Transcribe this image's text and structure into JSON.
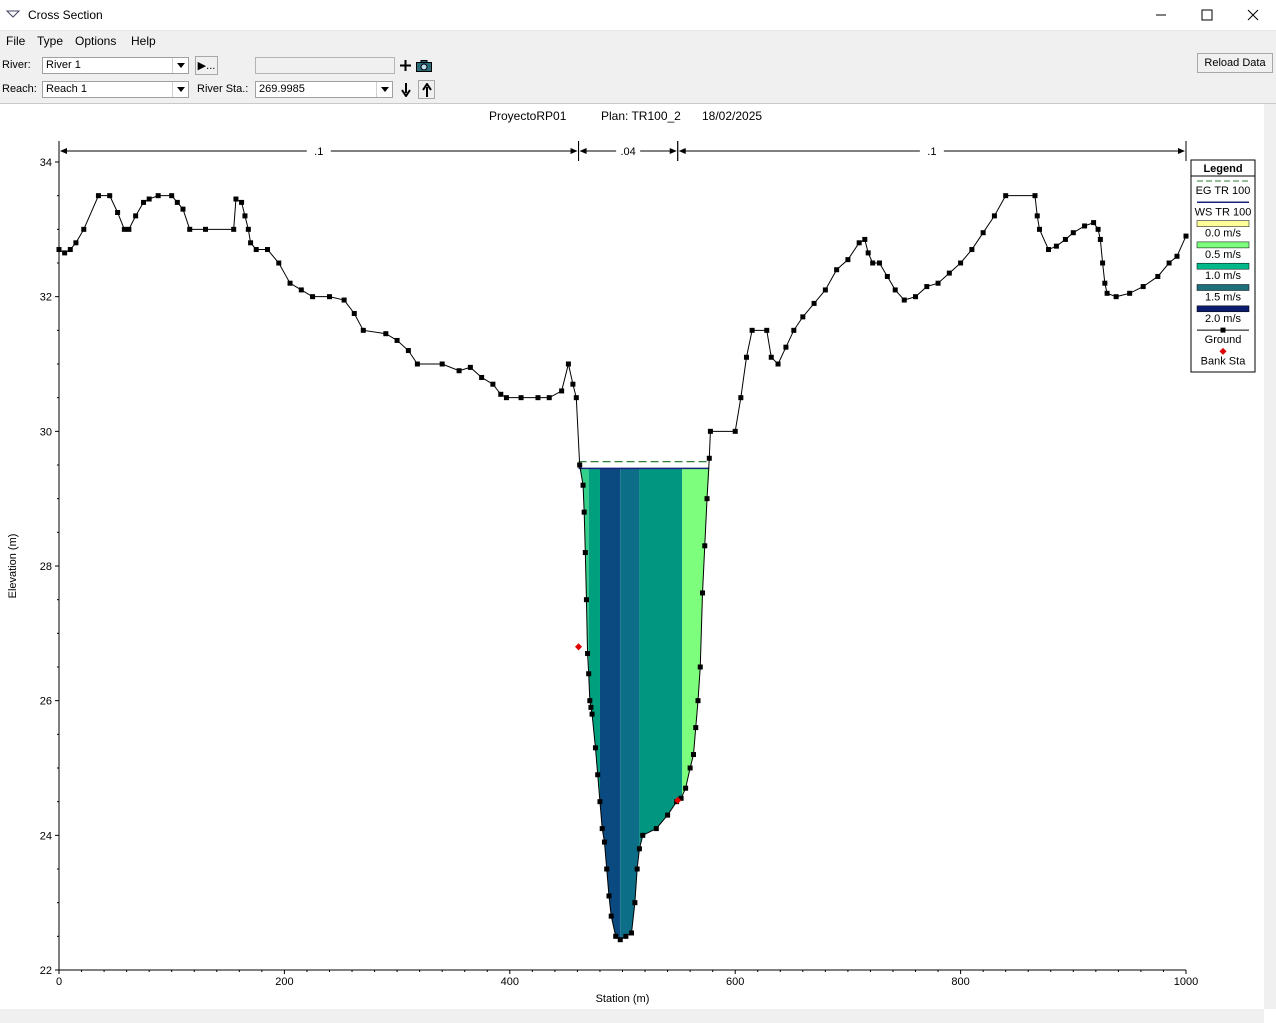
{
  "window": {
    "title": "Cross Section"
  },
  "menu": {
    "file": "File",
    "type": "Type",
    "options": "Options",
    "help": "Help"
  },
  "toolbar": {
    "river_label": "River:",
    "river_value": "River 1",
    "reach_label": "Reach:",
    "reach_value": "Reach 1",
    "river_sta_label": "River Sta.:",
    "river_sta_value": "269.9985",
    "reload_label": "Reload Data",
    "play_label": "▶..."
  },
  "plot": {
    "header_project": "ProyectoRP01",
    "header_plan": "Plan: TR100_2",
    "header_date": "18/02/2025",
    "n_values": [
      ".1",
      ".04",
      ".1"
    ]
  },
  "legend": {
    "title": "Legend",
    "items": [
      {
        "label": "EG TR 100",
        "symbol": "dash",
        "color": "#2e7d32"
      },
      {
        "label": "WS TR 100",
        "symbol": "line",
        "color": "#1a237e"
      },
      {
        "label": "0.0 m/s",
        "symbol": "fill",
        "color": "#ffff99"
      },
      {
        "label": "0.5 m/s",
        "symbol": "fill",
        "color": "#7cff7c"
      },
      {
        "label": "1.0 m/s",
        "symbol": "fill",
        "color": "#00b98b"
      },
      {
        "label": "1.5 m/s",
        "symbol": "fill",
        "color": "#1f6f7a"
      },
      {
        "label": "2.0 m/s",
        "symbol": "fill",
        "color": "#0d1b6e"
      },
      {
        "label": "Ground",
        "symbol": "ground",
        "color": "#000000"
      },
      {
        "label": "Bank Sta",
        "symbol": "bank",
        "color": "#e00000"
      }
    ]
  },
  "chart_data": {
    "type": "line",
    "xlabel": "Station (m)",
    "ylabel": "Elevation (m)",
    "xlim": [
      0,
      1000
    ],
    "ylim": [
      22,
      34.5
    ],
    "x_ticks": [
      0,
      200,
      400,
      600,
      800,
      1000
    ],
    "y_ticks": [
      22,
      24,
      26,
      28,
      30,
      32,
      34
    ],
    "ground": [
      [
        0,
        32.7
      ],
      [
        5,
        32.65
      ],
      [
        10,
        32.7
      ],
      [
        15,
        32.8
      ],
      [
        22,
        33
      ],
      [
        35,
        33.5
      ],
      [
        45,
        33.5
      ],
      [
        52,
        33.25
      ],
      [
        58,
        33
      ],
      [
        62,
        33
      ],
      [
        68,
        33.2
      ],
      [
        75,
        33.4
      ],
      [
        80,
        33.45
      ],
      [
        88,
        33.5
      ],
      [
        100,
        33.5
      ],
      [
        105,
        33.4
      ],
      [
        110,
        33.3
      ],
      [
        116,
        33
      ],
      [
        130,
        33
      ],
      [
        155,
        33
      ],
      [
        157,
        33.45
      ],
      [
        162,
        33.4
      ],
      [
        165,
        33.2
      ],
      [
        168,
        33
      ],
      [
        170,
        32.8
      ],
      [
        175,
        32.7
      ],
      [
        185,
        32.7
      ],
      [
        195,
        32.5
      ],
      [
        205,
        32.2
      ],
      [
        215,
        32.1
      ],
      [
        225,
        32
      ],
      [
        240,
        32
      ],
      [
        253,
        31.95
      ],
      [
        262,
        31.75
      ],
      [
        270,
        31.5
      ],
      [
        290,
        31.45
      ],
      [
        300,
        31.35
      ],
      [
        310,
        31.2
      ],
      [
        318,
        31
      ],
      [
        340,
        31
      ],
      [
        355,
        30.9
      ],
      [
        365,
        30.95
      ],
      [
        375,
        30.8
      ],
      [
        385,
        30.7
      ],
      [
        392,
        30.55
      ],
      [
        397,
        30.5
      ],
      [
        410,
        30.5
      ],
      [
        425,
        30.5
      ],
      [
        435,
        30.5
      ],
      [
        446,
        30.6
      ],
      [
        452,
        31
      ],
      [
        456,
        30.7
      ],
      [
        459,
        30.5
      ],
      [
        462,
        29.5
      ],
      [
        465,
        29.2
      ],
      [
        466,
        28.8
      ],
      [
        467,
        28.2
      ],
      [
        468,
        27.5
      ],
      [
        469,
        26.7
      ],
      [
        470,
        26.4
      ],
      [
        471,
        26
      ],
      [
        472,
        25.9
      ],
      [
        473,
        25.8
      ],
      [
        476,
        25.3
      ],
      [
        478,
        24.9
      ],
      [
        480,
        24.5
      ],
      [
        482,
        24.1
      ],
      [
        484,
        23.9
      ],
      [
        486,
        23.5
      ],
      [
        488,
        23.1
      ],
      [
        490,
        22.8
      ],
      [
        494,
        22.5
      ],
      [
        498,
        22.45
      ],
      [
        503,
        22.5
      ],
      [
        508,
        22.55
      ],
      [
        511,
        23
      ],
      [
        513,
        23.5
      ],
      [
        515,
        23.8
      ],
      [
        518,
        24
      ],
      [
        530,
        24.1
      ],
      [
        540,
        24.3
      ],
      [
        548,
        24.5
      ],
      [
        552,
        24.55
      ],
      [
        556,
        24.7
      ],
      [
        560,
        25
      ],
      [
        563,
        25.2
      ],
      [
        565,
        25.6
      ],
      [
        567,
        26
      ],
      [
        569,
        26.5
      ],
      [
        571,
        27.6
      ],
      [
        573,
        28.3
      ],
      [
        575,
        29
      ],
      [
        577,
        29.6
      ],
      [
        578,
        30
      ],
      [
        600,
        30
      ],
      [
        605,
        30.5
      ],
      [
        610,
        31.1
      ],
      [
        615,
        31.5
      ],
      [
        628,
        31.5
      ],
      [
        632,
        31.1
      ],
      [
        638,
        31.0
      ],
      [
        645,
        31.25
      ],
      [
        652,
        31.5
      ],
      [
        660,
        31.7
      ],
      [
        670,
        31.9
      ],
      [
        680,
        32.1
      ],
      [
        690,
        32.4
      ],
      [
        700,
        32.55
      ],
      [
        710,
        32.8
      ],
      [
        715,
        32.85
      ],
      [
        718,
        32.65
      ],
      [
        722,
        32.5
      ],
      [
        728,
        32.5
      ],
      [
        735,
        32.3
      ],
      [
        742,
        32.1
      ],
      [
        750,
        31.95
      ],
      [
        760,
        32
      ],
      [
        770,
        32.15
      ],
      [
        780,
        32.2
      ],
      [
        790,
        32.35
      ],
      [
        800,
        32.5
      ],
      [
        810,
        32.7
      ],
      [
        820,
        32.95
      ],
      [
        830,
        33.2
      ],
      [
        840,
        33.5
      ],
      [
        866,
        33.5
      ],
      [
        868,
        33.2
      ],
      [
        870,
        33
      ],
      [
        878,
        32.7
      ],
      [
        885,
        32.75
      ],
      [
        893,
        32.85
      ],
      [
        900,
        32.95
      ],
      [
        910,
        33.05
      ],
      [
        918,
        33.1
      ],
      [
        922,
        33
      ],
      [
        924,
        32.85
      ],
      [
        926,
        32.5
      ],
      [
        928,
        32.2
      ],
      [
        930,
        32.05
      ],
      [
        938,
        32
      ],
      [
        950,
        32.05
      ],
      [
        962,
        32.15
      ],
      [
        975,
        32.3
      ],
      [
        985,
        32.5
      ],
      [
        992,
        32.6
      ],
      [
        1000,
        32.9
      ]
    ],
    "ws_elev": 29.45,
    "eg_elev": 29.55,
    "bank_stations": [
      [
        461,
        26.8
      ],
      [
        549,
        24.52
      ]
    ],
    "velocity_bands": [
      {
        "from": 462,
        "to": 470,
        "value": 0.5
      },
      {
        "from": 470,
        "to": 480,
        "value": 1.0
      },
      {
        "from": 480,
        "to": 498,
        "value": 2.0
      },
      {
        "from": 498,
        "to": 515,
        "value": 1.5
      },
      {
        "from": 515,
        "to": 553,
        "value": 1.0
      },
      {
        "from": 553,
        "to": 577,
        "value": 0.5
      }
    ]
  }
}
